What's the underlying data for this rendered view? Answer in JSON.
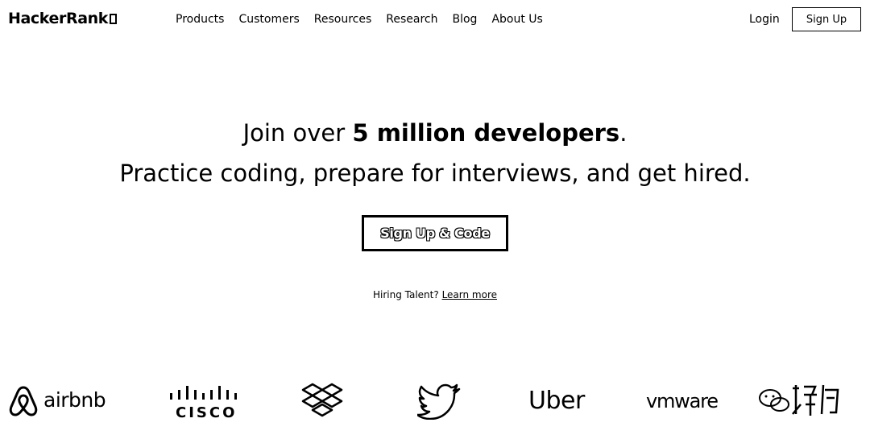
{
  "header": {
    "logo_text": "HackerRank",
    "nav": [
      "Products",
      "Customers",
      "Resources",
      "Research",
      "Blog",
      "About Us"
    ],
    "login_label": "Login",
    "signup_label": "Sign Up"
  },
  "hero": {
    "line1_prefix": "Join over ",
    "line1_bold": "5 million developers",
    "line1_suffix": ".",
    "line2": "Practice coding, prepare for interviews, and get hired.",
    "cta_label": "Sign Up & Code"
  },
  "hiring": {
    "text": "Hiring Talent? ",
    "link": "Learn more"
  },
  "brands": {
    "airbnb": "airbnb",
    "cisco": "CISCO",
    "uber": "Uber",
    "vmware": "vmware",
    "icons": [
      "airbnb-icon",
      "cisco-icon",
      "dropbox-icon",
      "twitter-bird-icon",
      "wechat-watermark-icon"
    ]
  }
}
